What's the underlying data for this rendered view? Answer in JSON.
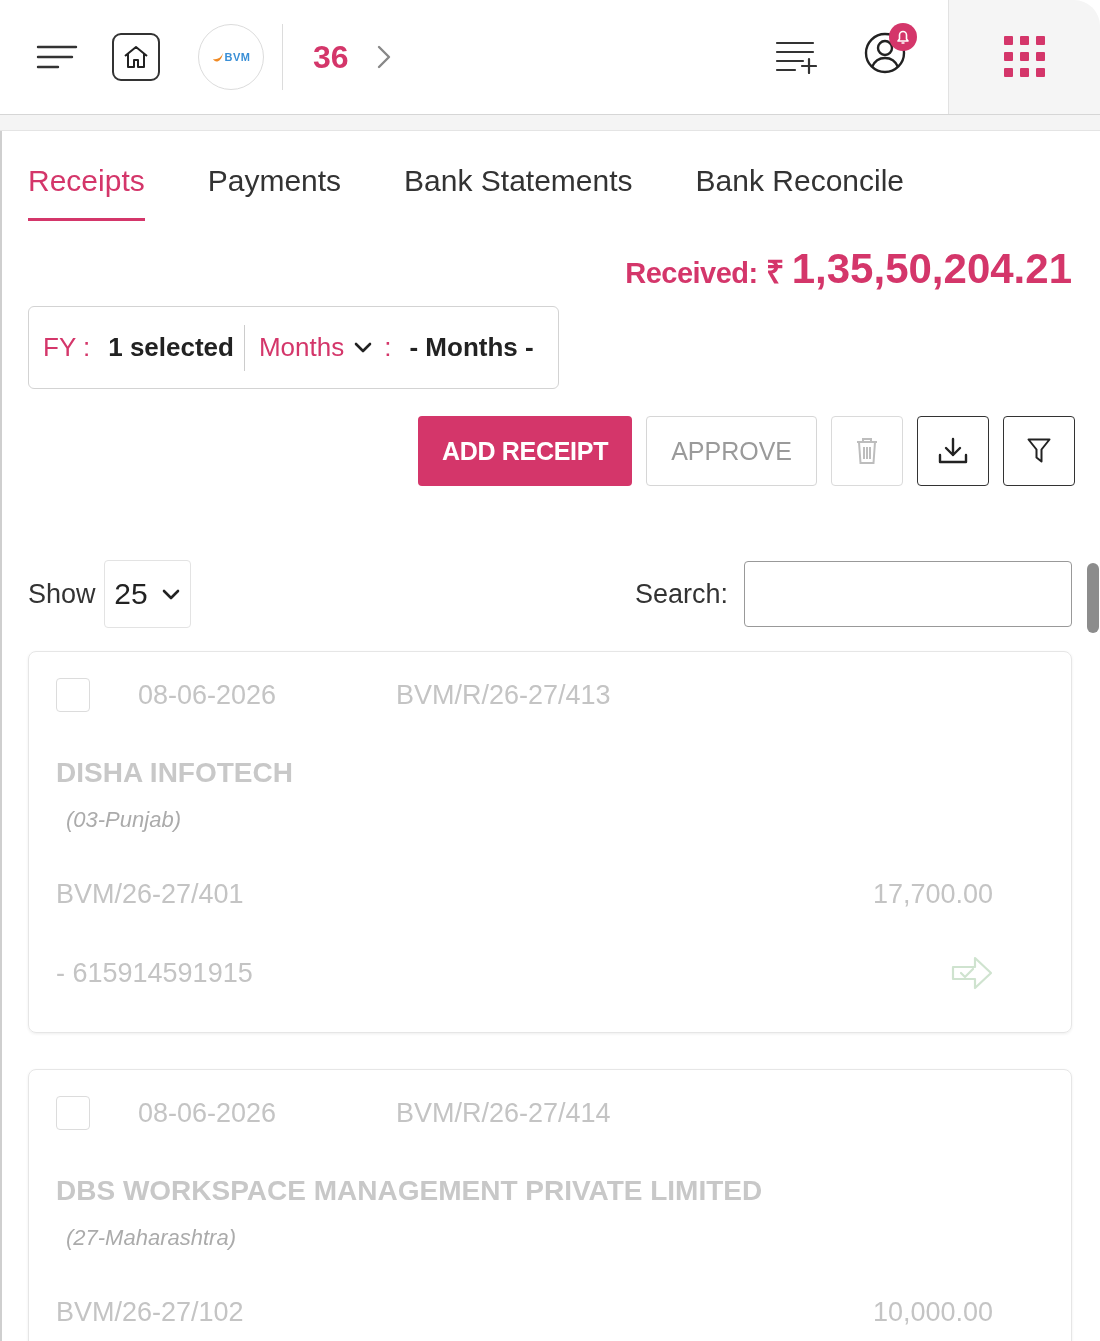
{
  "header": {
    "logo_text": "BVM",
    "counter": "36"
  },
  "tabs": [
    {
      "label": "Receipts",
      "selected": true
    },
    {
      "label": "Payments",
      "selected": false
    },
    {
      "label": "Bank Statements",
      "selected": false
    },
    {
      "label": "Bank Reconcile",
      "selected": false
    }
  ],
  "summary": {
    "label": "Received:",
    "currency": "₹",
    "amount": "1,35,50,204.21"
  },
  "filters": {
    "fy_label": "FY :",
    "fy_value": "1 selected",
    "months_label": "Months",
    "months_separator": ":",
    "months_value": "- Months -"
  },
  "actions": {
    "add": {
      "label": "ADD RECEIPT"
    },
    "approve": {
      "label": "APPROVE",
      "disabled": true
    },
    "tools": [
      {
        "kind": "delete",
        "disabled": true
      },
      {
        "kind": "download",
        "disabled": false
      },
      {
        "kind": "filter",
        "disabled": false
      }
    ]
  },
  "list_controls": {
    "show_label": "Show",
    "page_size": "25",
    "search_label": "Search:"
  },
  "receipts": [
    {
      "checked": false,
      "date": "08-06-2026",
      "number": "BVM/R/26-27/413",
      "party": "DISHA INFOTECH",
      "state": "(03-Punjab)",
      "invoice": "BVM/26-27/401",
      "amount": "17,700.00",
      "reference": "- 615914591915"
    },
    {
      "checked": false,
      "date": "08-06-2026",
      "number": "BVM/R/26-27/414",
      "party": "DBS WORKSPACE MANAGEMENT PRIVATE LIMITED",
      "state": "(27-Maharashtra)",
      "invoice": "BVM/26-27/102",
      "amount": "10,000.00"
    }
  ]
}
